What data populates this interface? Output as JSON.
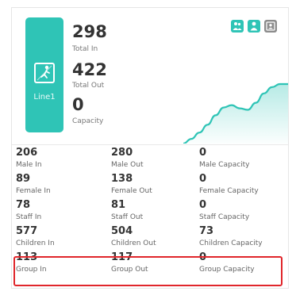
{
  "line_label": "Line1",
  "totals": [
    {
      "value": "298",
      "label": "Total In"
    },
    {
      "value": "422",
      "label": "Total Out"
    },
    {
      "value": "0",
      "label": "Capacity"
    }
  ],
  "header_icons": [
    "person-group-icon",
    "person-icon",
    "id-card-icon"
  ],
  "colors": {
    "accent": "#2fc4b6",
    "highlight": "#e0262b",
    "icon_gray": "#8c8c8c"
  },
  "stats": [
    {
      "in_value": "206",
      "in_label": "Male In",
      "out_value": "280",
      "out_label": "Male Out",
      "cap_value": "0",
      "cap_label": "Male Capacity"
    },
    {
      "in_value": "89",
      "in_label": "Female In",
      "out_value": "138",
      "out_label": "Female Out",
      "cap_value": "0",
      "cap_label": "Female Capacity"
    },
    {
      "in_value": "78",
      "in_label": "Staff In",
      "out_value": "81",
      "out_label": "Staff Out",
      "cap_value": "0",
      "cap_label": "Staff Capacity"
    },
    {
      "in_value": "577",
      "in_label": "Children In",
      "out_value": "504",
      "out_label": "Children Out",
      "cap_value": "73",
      "cap_label": "Children Capacity"
    },
    {
      "in_value": "113",
      "in_label": "Group In",
      "out_value": "117",
      "out_label": "Group Out",
      "cap_value": "0",
      "cap_label": "Group Capacity"
    }
  ],
  "chart_data": {
    "type": "area",
    "title": "",
    "xlabel": "",
    "ylabel": "",
    "series": [
      {
        "values": [
          0,
          6,
          14,
          24,
          36,
          46,
          49,
          45,
          43,
          52,
          64,
          72,
          76,
          76
        ]
      }
    ],
    "ylim": [
      0,
      80
    ],
    "grid": false
  }
}
